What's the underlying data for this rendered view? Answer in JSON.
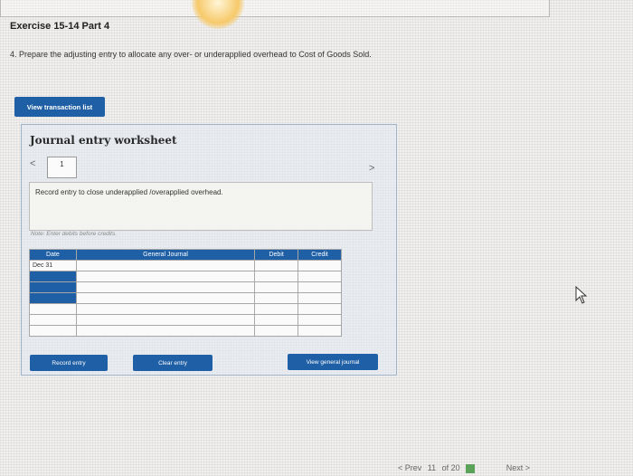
{
  "header": {
    "exercise_title": "Exercise 15-14 Part 4"
  },
  "instruction": "4. Prepare the adjusting entry to allocate any over- or underapplied overhead to Cost of Goods Sold.",
  "buttons": {
    "view_transaction_list": "View transaction list",
    "record_entry": "Record entry",
    "clear_entry": "Clear entry",
    "view_general_journal": "View general journal"
  },
  "worksheet": {
    "title": "Journal entry worksheet",
    "prev_glyph": "<",
    "next_glyph": ">",
    "tab_number": "1",
    "entry_description": "Record entry to close underapplied /overapplied overhead.",
    "note": "Note: Enter debits before credits."
  },
  "journal_table": {
    "headers": [
      "Date",
      "General Journal",
      "Debit",
      "Credit"
    ],
    "rows": [
      [
        "Dec 31",
        "",
        "",
        ""
      ],
      [
        "",
        "",
        "",
        ""
      ],
      [
        "",
        "",
        "",
        ""
      ],
      [
        "",
        "",
        "",
        ""
      ],
      [
        "",
        "",
        "",
        ""
      ],
      [
        "",
        "",
        "",
        ""
      ],
      [
        "",
        "",
        "",
        ""
      ]
    ]
  },
  "footer": {
    "prev_label": "< Prev",
    "page_current": "11",
    "page_of": "of 20",
    "next_label": "Next >"
  },
  "colors": {
    "accent": "#1f5fa5"
  },
  "icons": [
    "mouse-cursor-icon",
    "grid-icon"
  ]
}
